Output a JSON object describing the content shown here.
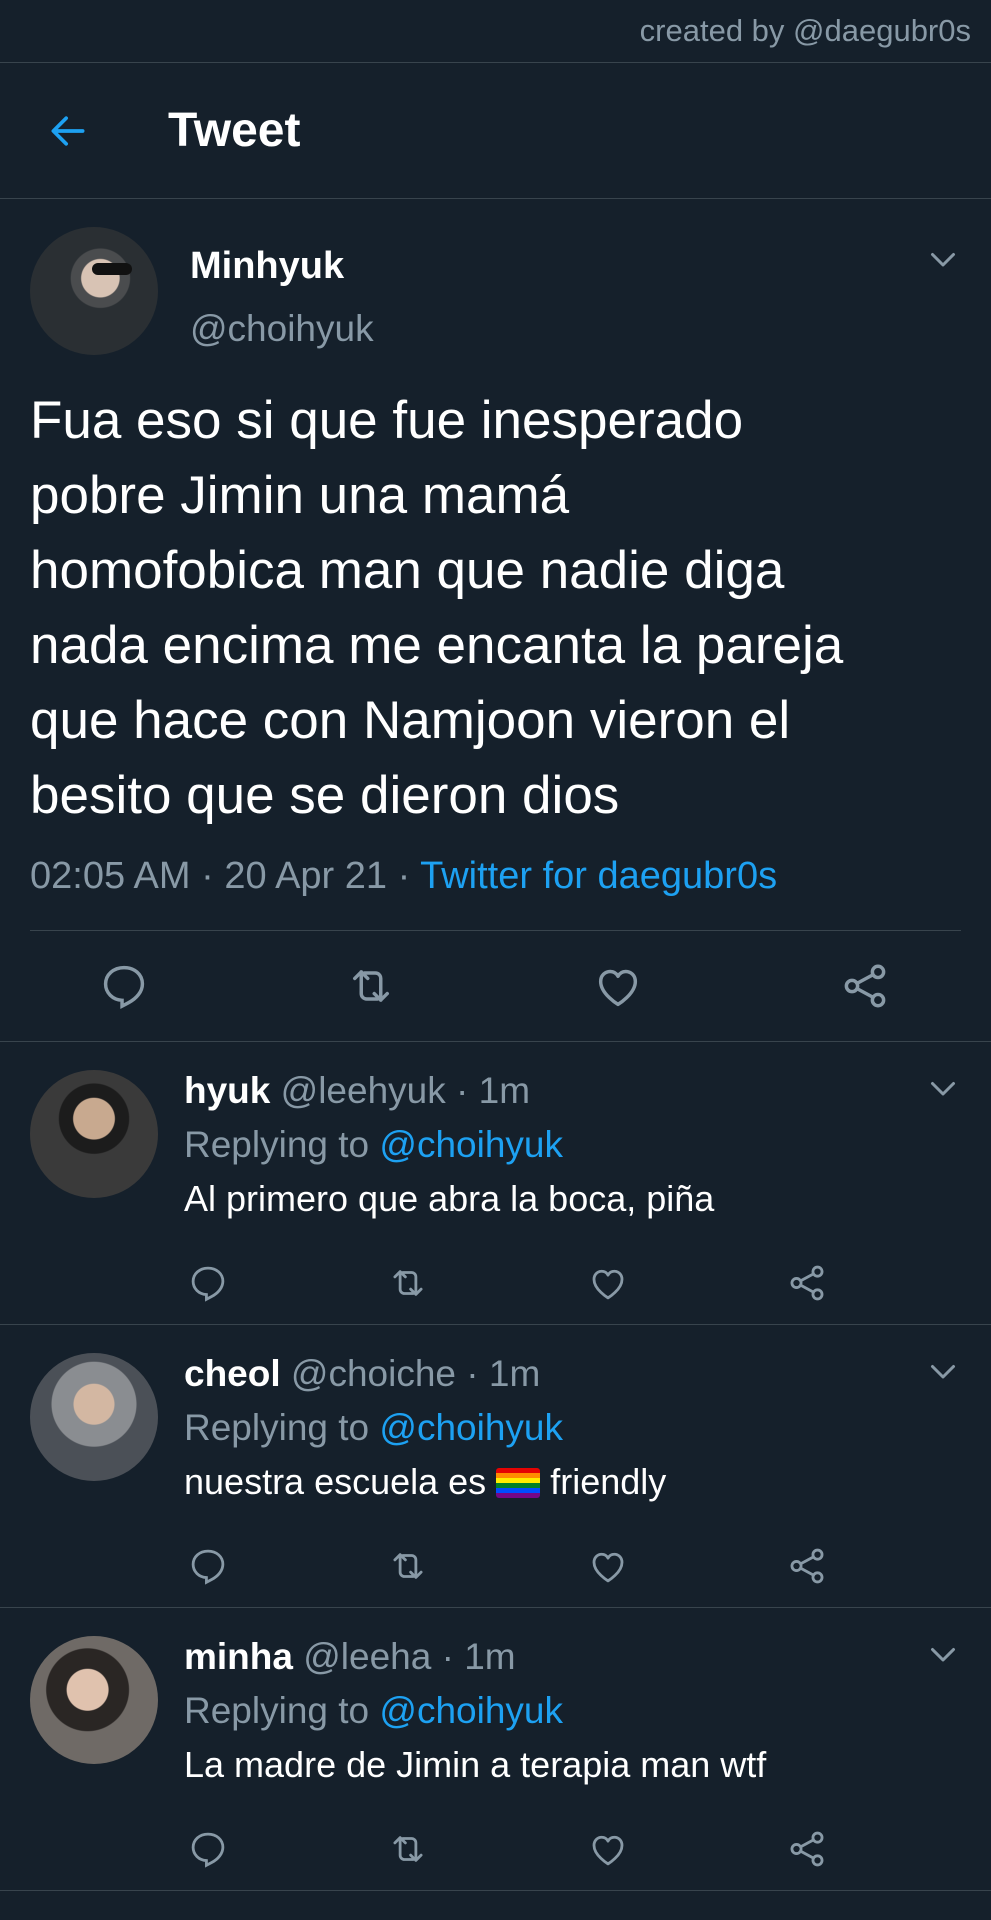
{
  "credit": "created by @daegubr0s",
  "header": {
    "title": "Tweet"
  },
  "tweet": {
    "name": "Minhyuk",
    "handle": "@choihyuk",
    "text": "Fua eso si que fue inesperado\npobre Jimin una mamá\nhomofobica man que nadie diga\nnada encima me encanta la pareja\nque hace con Namjoon vieron el\nbesito que se dieron dios",
    "time": "02:05 AM",
    "date": "20 Apr 21",
    "source": "Twitter for daegubr0s"
  },
  "replies": [
    {
      "name": "hyuk",
      "handle": "@leehyuk",
      "time": "1m",
      "replying_label": "Replying to",
      "replying_to": "@choihyuk",
      "text": "Al primero que abra la boca, piña"
    },
    {
      "name": "cheol",
      "handle": "@choiche",
      "time": "1m",
      "replying_label": "Replying to",
      "replying_to": "@choihyuk",
      "text_before": "nuestra escuela es",
      "text_after": "friendly"
    },
    {
      "name": "minha",
      "handle": "@leeha",
      "time": "1m",
      "replying_label": "Replying to",
      "replying_to": "@choihyuk",
      "text": "La madre de Jimin a terapia man wtf"
    }
  ],
  "icons": {
    "back": "arrow-left-icon",
    "reply": "comment-icon",
    "retweet": "retweet-icon",
    "like": "heart-icon",
    "share": "share-icon",
    "more": "chevron-down-icon"
  },
  "colors": {
    "background": "#15202b",
    "accent": "#1da1f2",
    "muted": "#8899a6",
    "divider": "#38444d"
  }
}
